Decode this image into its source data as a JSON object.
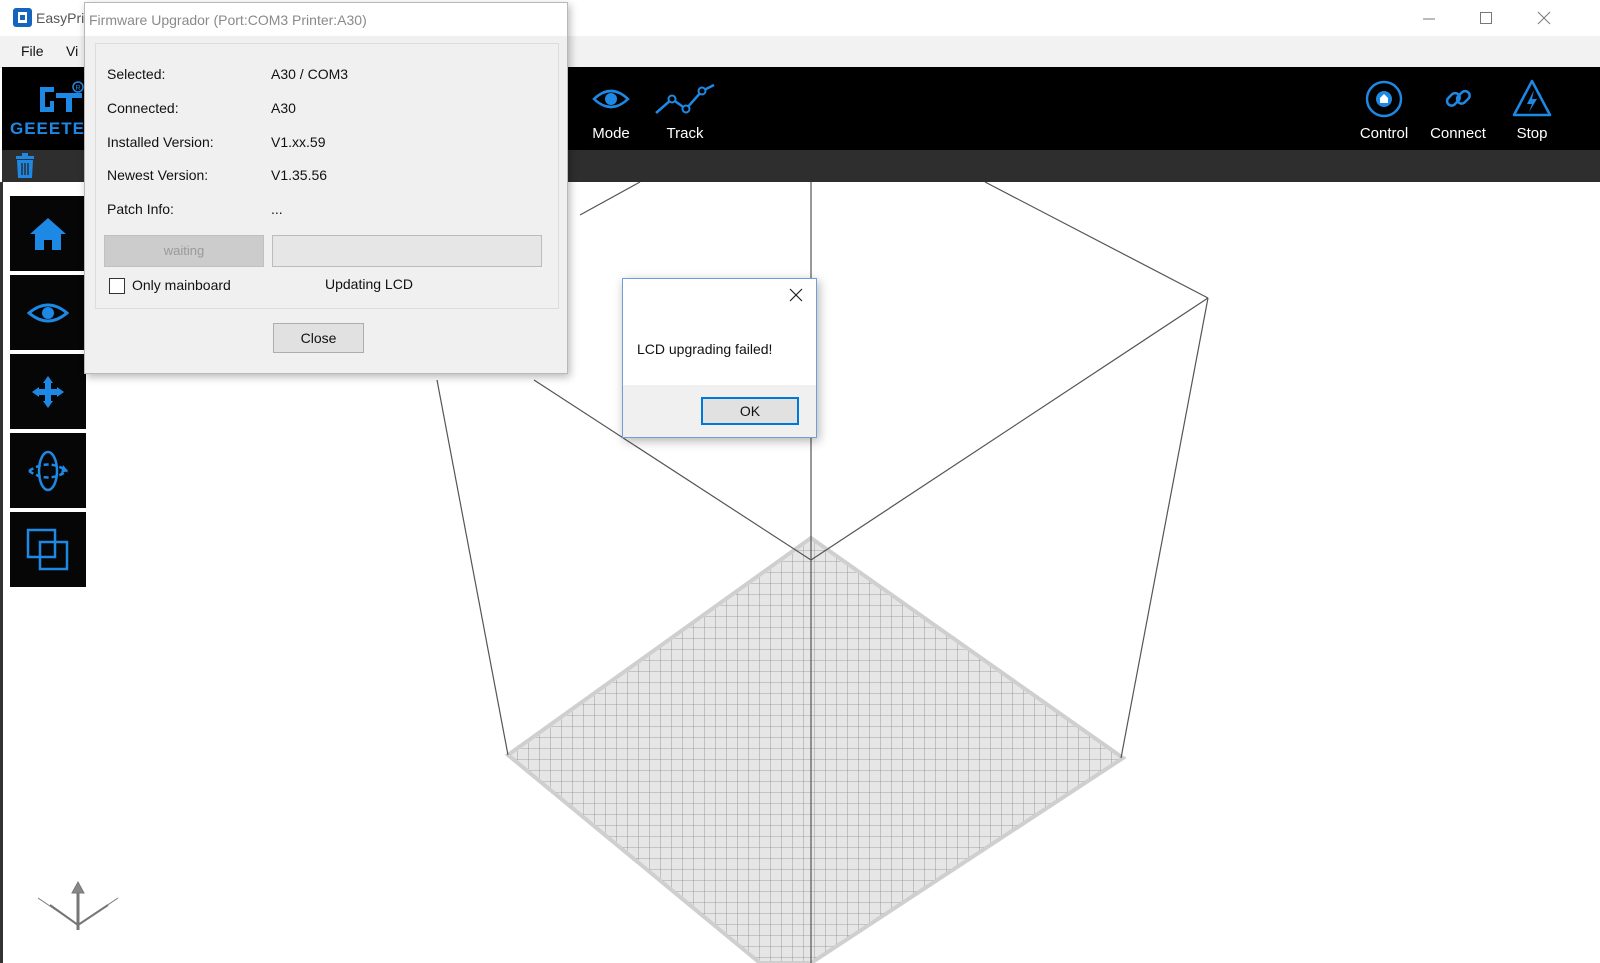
{
  "app": {
    "title": "EasyPri"
  },
  "menu": {
    "items": [
      "File",
      "Vi"
    ]
  },
  "toolbar": {
    "logo_text": "GEEETE",
    "tools_center": [
      {
        "label": "Mode",
        "icon": "eye-icon"
      },
      {
        "label": "Track",
        "icon": "track-icon"
      }
    ],
    "tools_right": [
      {
        "label": "Control",
        "icon": "control-icon"
      },
      {
        "label": "Connect",
        "icon": "link-icon"
      },
      {
        "label": "Stop",
        "icon": "stop-icon"
      }
    ]
  },
  "sidebar": {
    "items": [
      "home-icon",
      "eye-icon",
      "move-icon",
      "rotate-icon",
      "layers-icon"
    ]
  },
  "firmware": {
    "title": "Firmware Upgrador (Port:COM3 Printer:A30)",
    "fields": [
      {
        "label": "Selected:",
        "value": "A30 / COM3"
      },
      {
        "label": "Connected:",
        "value": "A30"
      },
      {
        "label": "Installed Version:",
        "value": "V1.xx.59"
      },
      {
        "label": "Newest Version:",
        "value": "V1.35.56"
      },
      {
        "label": "Patch Info:",
        "value": "..."
      }
    ],
    "wait_label": "waiting",
    "checkbox_label": "Only mainboard",
    "status": "Updating LCD",
    "close_label": "Close"
  },
  "message": {
    "text": "LCD upgrading failed!",
    "ok_label": "OK"
  },
  "colors": {
    "accent": "#1e88e5",
    "toolbar_bg": "#000000",
    "dialog_bg": "#f0f0f0",
    "focus_blue": "#0078d7"
  }
}
